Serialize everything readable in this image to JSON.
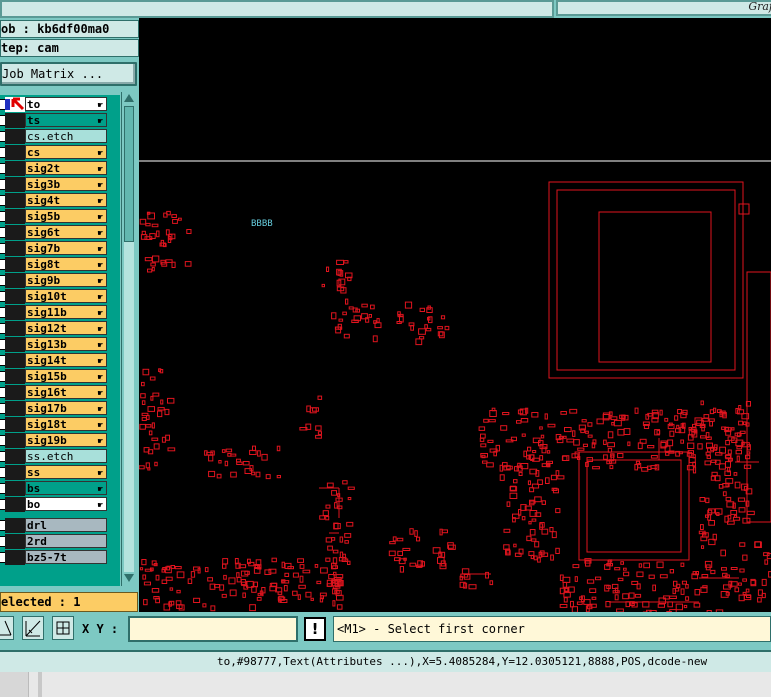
{
  "window": {
    "title_right": "Graf"
  },
  "job_info": {
    "job_line": "ob : kb6df00ma0",
    "step_line": "tep: cam",
    "job_matrix_label": "Job Matrix ..."
  },
  "layers": [
    {
      "name": "to",
      "color": "#ffffff",
      "kind": "layer",
      "active": true
    },
    {
      "name": "ts",
      "color": "#00a08a",
      "kind": "layer"
    },
    {
      "name": "cs.etch",
      "color": "#a8e0da",
      "kind": "separator"
    },
    {
      "name": "cs",
      "color": "#fccc64",
      "kind": "layer"
    },
    {
      "name": "sig2t",
      "color": "#fccc64",
      "kind": "layer"
    },
    {
      "name": "sig3b",
      "color": "#fccc64",
      "kind": "layer"
    },
    {
      "name": "sig4t",
      "color": "#fccc64",
      "kind": "layer"
    },
    {
      "name": "sig5b",
      "color": "#fccc64",
      "kind": "layer"
    },
    {
      "name": "sig6t",
      "color": "#fccc64",
      "kind": "layer"
    },
    {
      "name": "sig7b",
      "color": "#fccc64",
      "kind": "layer"
    },
    {
      "name": "sig8t",
      "color": "#fccc64",
      "kind": "layer"
    },
    {
      "name": "sig9b",
      "color": "#fccc64",
      "kind": "layer"
    },
    {
      "name": "sig10t",
      "color": "#fccc64",
      "kind": "layer"
    },
    {
      "name": "sig11b",
      "color": "#fccc64",
      "kind": "layer"
    },
    {
      "name": "sig12t",
      "color": "#fccc64",
      "kind": "layer"
    },
    {
      "name": "sig13b",
      "color": "#fccc64",
      "kind": "layer"
    },
    {
      "name": "sig14t",
      "color": "#fccc64",
      "kind": "layer"
    },
    {
      "name": "sig15b",
      "color": "#fccc64",
      "kind": "layer"
    },
    {
      "name": "sig16t",
      "color": "#fccc64",
      "kind": "layer"
    },
    {
      "name": "sig17b",
      "color": "#fccc64",
      "kind": "layer"
    },
    {
      "name": "sig18t",
      "color": "#fccc64",
      "kind": "layer"
    },
    {
      "name": "sig19b",
      "color": "#fccc64",
      "kind": "layer"
    },
    {
      "name": "ss.etch",
      "color": "#a8e0da",
      "kind": "separator"
    },
    {
      "name": "ss",
      "color": "#fccc64",
      "kind": "layer"
    },
    {
      "name": "bs",
      "color": "#00a08a",
      "kind": "layer"
    },
    {
      "name": "bo",
      "color": "#ffffff",
      "kind": "layer"
    },
    {
      "name": "",
      "color": "#00a08a",
      "kind": "gap"
    },
    {
      "name": "drl",
      "color": "#a8b8c0",
      "kind": "layer"
    },
    {
      "name": "2rd",
      "color": "#a8b8c0",
      "kind": "layer"
    },
    {
      "name": "bz5-7t",
      "color": "#a8b8c0",
      "kind": "layer"
    }
  ],
  "selected_label": "elected : 1",
  "canvas": {
    "label_bbbb": "BBBB",
    "trace_color": "#e0141e",
    "highlight_color": "#66ccdd"
  },
  "toolbar": {
    "xy_label": "X Y :",
    "xy_value": "",
    "warn_glyph": "!",
    "message": "<M1> - Select first corner"
  },
  "status_bar": {
    "text": "to,#98777,Text(Attributes ...),X=5.4085284,Y=12.0305121,8888,POS,dcode-new"
  },
  "colors": {
    "panel": "#7dc9c3",
    "list_bg": "#00a08a",
    "signal_layer": "#fccc64"
  }
}
